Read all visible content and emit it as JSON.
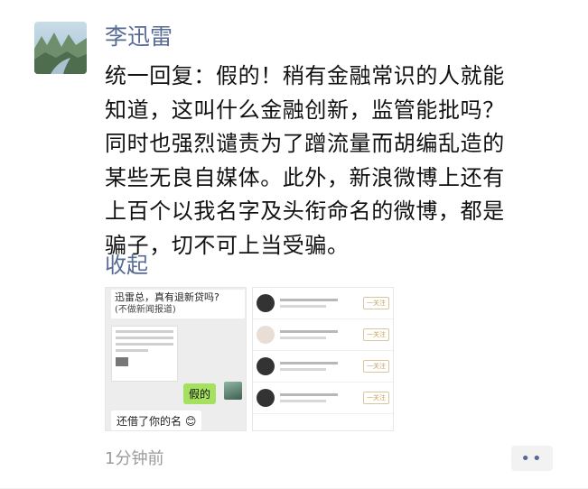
{
  "post": {
    "author": "李迅雷",
    "content_lines": [
      "统一回复：假的！稍有金融常识的人就能",
      "知道，这叫什么金融创新，监管能批吗？",
      "同时也强烈谴责为了蹭流量而胡编乱造的",
      "某些无良自媒体。此外，新浪微博上还有",
      "上百个以我名字及头衔命名的微博，都是",
      "骗子，切不可上当受骗。"
    ],
    "collapse_label": "收起",
    "time": "1分钟前",
    "more_label": "••"
  },
  "thumbnail_chat": {
    "question_line1": "迅雷总，真有退新贷吗?",
    "question_line2": "(不做新闻报道)",
    "reply": "假的",
    "borrow": "还借了你的名"
  },
  "thumbnail_weibo_list": {
    "follow_label": "一关注",
    "rows": [
      {
        "name": ""
      },
      {
        "name": "李迅雷"
      },
      {
        "name": "李迅雷金融研报"
      },
      {
        "name": "李迅雷新媒体"
      },
      {
        "name": "李迅雷一九五0(私)"
      }
    ]
  },
  "colors": {
    "link": "#576b95",
    "text": "#111111",
    "time": "#9b9b9b",
    "reply_bubble": "#a6e05f"
  }
}
